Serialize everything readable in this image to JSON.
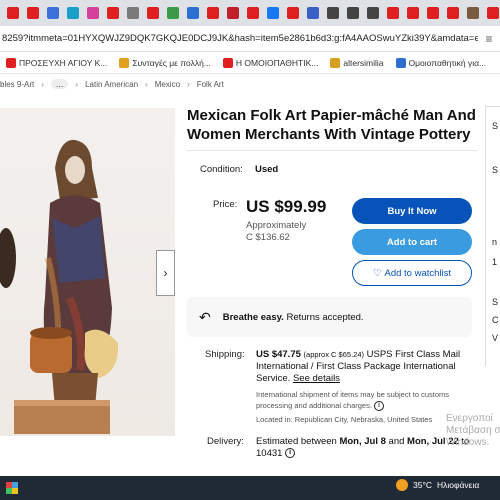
{
  "browser": {
    "tabs": [
      {
        "icon": "youtube-icon",
        "color": "#e02020"
      },
      {
        "icon": "youtube-icon",
        "color": "#e02020"
      },
      {
        "icon": "globe-icon",
        "color": "#3b6fd9"
      },
      {
        "icon": "stethoscope-icon",
        "color": "#1aa0c8"
      },
      {
        "icon": "pink-site-icon",
        "color": "#d6409a"
      },
      {
        "icon": "youtube-icon",
        "color": "#e02020"
      },
      {
        "icon": "tab-icon",
        "color": "#7a7a7a"
      },
      {
        "icon": "youtube-icon",
        "color": "#e02020"
      },
      {
        "icon": "leaf-icon",
        "color": "#3a9a45"
      },
      {
        "icon": "blue-square-icon",
        "color": "#2d6fd0"
      },
      {
        "icon": "youtube-icon",
        "color": "#e02020"
      },
      {
        "icon": "red-badge-icon",
        "color": "#c0202a"
      },
      {
        "icon": "youtube-icon",
        "color": "#e02020"
      },
      {
        "icon": "facebook-icon",
        "color": "#1877f2"
      },
      {
        "icon": "youtube-icon",
        "color": "#e02020"
      },
      {
        "icon": "document-icon",
        "color": "#3a60c8"
      },
      {
        "icon": "bag-icon",
        "color": "#444444"
      },
      {
        "icon": "bag-icon",
        "color": "#444444"
      },
      {
        "icon": "bag-icon",
        "color": "#444444"
      },
      {
        "icon": "youtube-icon",
        "color": "#e02020"
      },
      {
        "icon": "youtube-icon",
        "color": "#e02020"
      },
      {
        "icon": "youtube-icon",
        "color": "#e02020"
      },
      {
        "icon": "youtube-icon",
        "color": "#e02020"
      },
      {
        "icon": "avatar-icon",
        "color": "#7a5a40"
      },
      {
        "icon": "youtube-icon",
        "color": "#e02020"
      },
      {
        "icon": "orange-b-icon",
        "color": "#f08a24"
      },
      {
        "icon": "youtube-icon",
        "color": "#e02020"
      },
      {
        "icon": "seal-icon",
        "color": "#888888"
      }
    ],
    "url": "8259?itmmeta=01HYXQWJZ9DQK7GKQJE0DCJ9JK&hash=item5e2861b6d3:g:fA4AAOSwuYZki39Y&amdata=enc%3...",
    "bookmarks": [
      {
        "label": "ΠΡΟΣΕΥΧΗ ΑΓΙΟΥ Κ...",
        "icon": "youtube-icon",
        "color": "#e02020"
      },
      {
        "label": "Συνταγές με πολλή...",
        "icon": "recipe-icon",
        "color": "#e0a020"
      },
      {
        "label": "Η ΟΜΟΙΟΠΑΘΗΤΙΚ...",
        "icon": "youtube-icon",
        "color": "#e02020"
      },
      {
        "label": "altersimilia",
        "icon": "leaf-icon",
        "color": "#d8a020"
      },
      {
        "label": "Ομοιοπαθητική για...",
        "icon": "page-icon",
        "color": "#2d6fd0"
      }
    ]
  },
  "breadcrumb": {
    "items": [
      "bles 9-Art",
      "...",
      "Latin American",
      "Mexico",
      "Folk Art"
    ]
  },
  "listing": {
    "title": "Mexican Folk Art Papier-mâché Man And Women Merchants With Vintage Pottery",
    "condition_label": "Condition:",
    "condition_value": "Used",
    "price_label": "Price:",
    "price": "US $99.99",
    "approx_line1": "Approximately",
    "approx_line2": "C $136.62",
    "buy_now": "Buy It Now",
    "add_to_cart": "Add to cart",
    "add_to_watchlist": "Add to watchlist",
    "returns_bold": "Breathe easy.",
    "returns_text": "Returns accepted.",
    "shipping_label": "Shipping:",
    "shipping_price": "US $47.75",
    "shipping_approx": "(approx C $65.24)",
    "shipping_service": "USPS First Class Mail International / First Class Package International Service.",
    "see_details": "See details",
    "shipping_note": "International shipment of items may be subject to customs processing and additional charges.",
    "located_in": "Located in: Republican City, Nebraska, United States",
    "delivery_label": "Delivery:",
    "delivery_text": "Estimated between",
    "delivery_from": "Mon, Jul 8",
    "delivery_and": "and",
    "delivery_to": "Mon, Jul 22",
    "delivery_zip": "to 10431"
  },
  "right_panel": {
    "letters": [
      "S",
      "S",
      "n",
      "1",
      "S",
      "C",
      "V",
      "R"
    ]
  },
  "watermark": {
    "line1": "Ενεργοποί",
    "line2": "Μετάβαση σ",
    "line3": "Windows."
  },
  "taskbar": {
    "weather_temp": "35°C",
    "weather_desc": "Ηλιοφάνεια"
  }
}
